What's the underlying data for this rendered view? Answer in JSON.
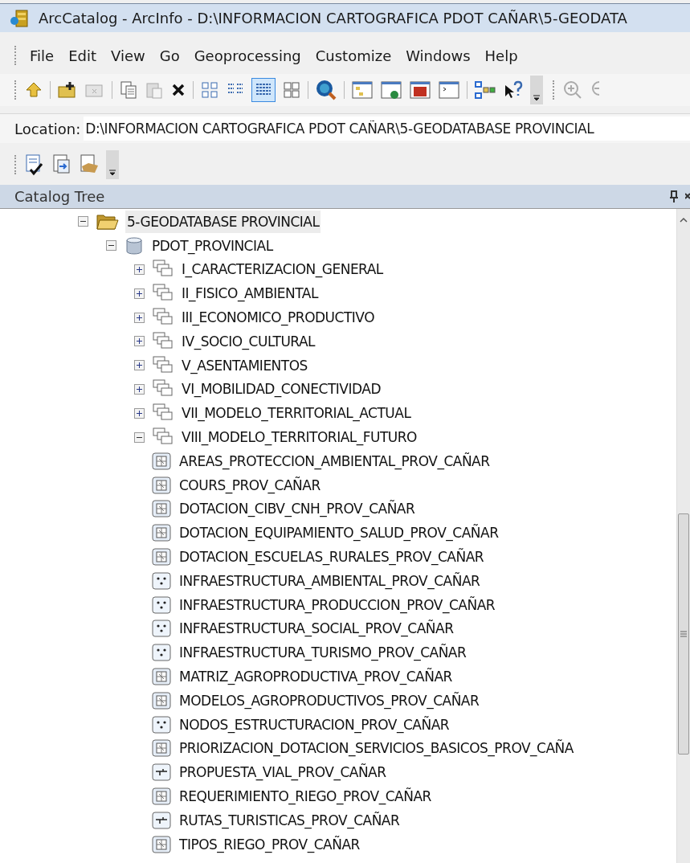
{
  "window": {
    "title": "ArcCatalog - ArcInfo - D:\\INFORMACION CARTOGRAFICA PDOT CAÑAR\\5-GEODATA"
  },
  "menu": [
    "File",
    "Edit",
    "View",
    "Go",
    "Geoprocessing",
    "Customize",
    "Windows",
    "Help"
  ],
  "location": {
    "label": "Location:",
    "value": "D:\\INFORMACION CARTOGRAFICA PDOT CAÑAR\\5-GEODATABASE PROVINCIAL"
  },
  "catalog_tree": {
    "title": "Catalog Tree",
    "items": [
      {
        "label": "5-GEODATABASE PROVINCIAL",
        "kind": "folder",
        "expanded": true,
        "selected": true,
        "children": [
          {
            "label": "PDOT_PROVINCIAL",
            "kind": "geodatabase",
            "expanded": true,
            "selected": false,
            "children": [
              {
                "label": "I_CARACTERIZACION_GENERAL",
                "kind": "dataset",
                "expanded": false,
                "selected": false
              },
              {
                "label": "II_FISICO_AMBIENTAL",
                "kind": "dataset",
                "expanded": false,
                "selected": false
              },
              {
                "label": "III_ECONOMICO_PRODUCTIVO",
                "kind": "dataset",
                "expanded": false,
                "selected": false
              },
              {
                "label": "IV_SOCIO_CULTURAL",
                "kind": "dataset",
                "expanded": false,
                "selected": false
              },
              {
                "label": "V_ASENTAMIENTOS",
                "kind": "dataset",
                "expanded": false,
                "selected": false
              },
              {
                "label": "VI_MOBILIDAD_CONECTIVIDAD",
                "kind": "dataset",
                "expanded": false,
                "selected": false
              },
              {
                "label": "VII_MODELO_TERRITORIAL_ACTUAL",
                "kind": "dataset",
                "expanded": false,
                "selected": false
              },
              {
                "label": "VIII_MODELO_TERRITORIAL_FUTURO",
                "kind": "dataset",
                "expanded": true,
                "selected": false,
                "children": [
                  {
                    "label": "AREAS_PROTECCION_AMBIENTAL_PROV_CAÑAR",
                    "kind": "polygon",
                    "selected": false
                  },
                  {
                    "label": "COURS_PROV_CAÑAR",
                    "kind": "polygon",
                    "selected": false
                  },
                  {
                    "label": "DOTACION_CIBV_CNH_PROV_CAÑAR",
                    "kind": "polygon",
                    "selected": false
                  },
                  {
                    "label": "DOTACION_EQUIPAMIENTO_SALUD_PROV_CAÑAR",
                    "kind": "polygon",
                    "selected": false
                  },
                  {
                    "label": "DOTACION_ESCUELAS_RURALES_PROV_CAÑAR",
                    "kind": "polygon",
                    "selected": false
                  },
                  {
                    "label": "INFRAESTRUCTURA_AMBIENTAL_PROV_CAÑAR",
                    "kind": "point",
                    "selected": false
                  },
                  {
                    "label": "INFRAESTRUCTURA_PRODUCCION_PROV_CAÑAR",
                    "kind": "point",
                    "selected": false
                  },
                  {
                    "label": "INFRAESTRUCTURA_SOCIAL_PROV_CAÑAR",
                    "kind": "point",
                    "selected": false
                  },
                  {
                    "label": "INFRAESTRUCTURA_TURISMO_PROV_CAÑAR",
                    "kind": "point",
                    "selected": false
                  },
                  {
                    "label": "MATRIZ_AGROPRODUCTIVA_PROV_CAÑAR",
                    "kind": "polygon",
                    "selected": false
                  },
                  {
                    "label": "MODELOS_AGROPRODUCTIVOS_PROV_CAÑAR",
                    "kind": "polygon",
                    "selected": false
                  },
                  {
                    "label": "NODOS_ESTRUCTURACION_PROV_CAÑAR",
                    "kind": "point",
                    "selected": false
                  },
                  {
                    "label": "PRIORIZACION_DOTACION_SERVICIOS_BASICOS_PROV_CAÑA",
                    "kind": "polygon",
                    "selected": false
                  },
                  {
                    "label": "PROPUESTA_VIAL_PROV_CAÑAR",
                    "kind": "line",
                    "selected": false
                  },
                  {
                    "label": "REQUERIMIENTO_RIEGO_PROV_CAÑAR",
                    "kind": "polygon",
                    "selected": false
                  },
                  {
                    "label": "RUTAS_TURISTICAS_PROV_CAÑAR",
                    "kind": "line",
                    "selected": false
                  },
                  {
                    "label": "TIPOS_RIEGO_PROV_CAÑAR",
                    "kind": "polygon",
                    "selected": false
                  }
                ]
              }
            ]
          }
        ]
      }
    ]
  }
}
